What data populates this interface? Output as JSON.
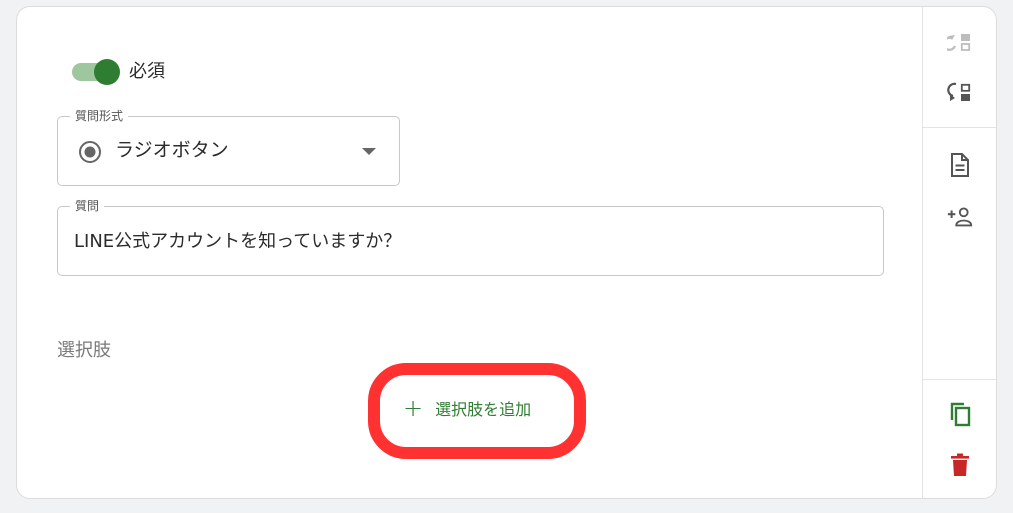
{
  "required": {
    "label": "必須",
    "on": true
  },
  "question_type": {
    "legend": "質問形式",
    "value": "ラジオボタン"
  },
  "question": {
    "legend": "質問",
    "value": "LINE公式アカウントを知っていますか？"
  },
  "choices": {
    "label": "選択肢",
    "add_label": "選択肢を追加",
    "add_icon": "+"
  },
  "side_icons": [
    "move-up-icon",
    "move-down-icon",
    "document-icon",
    "add-person-icon",
    "copy-icon",
    "delete-icon"
  ],
  "colors": {
    "accent_green": "#2e7d32",
    "toggle_track": "#9fc79f",
    "delete_red": "#c62828",
    "highlight_red": "#ff3131"
  }
}
